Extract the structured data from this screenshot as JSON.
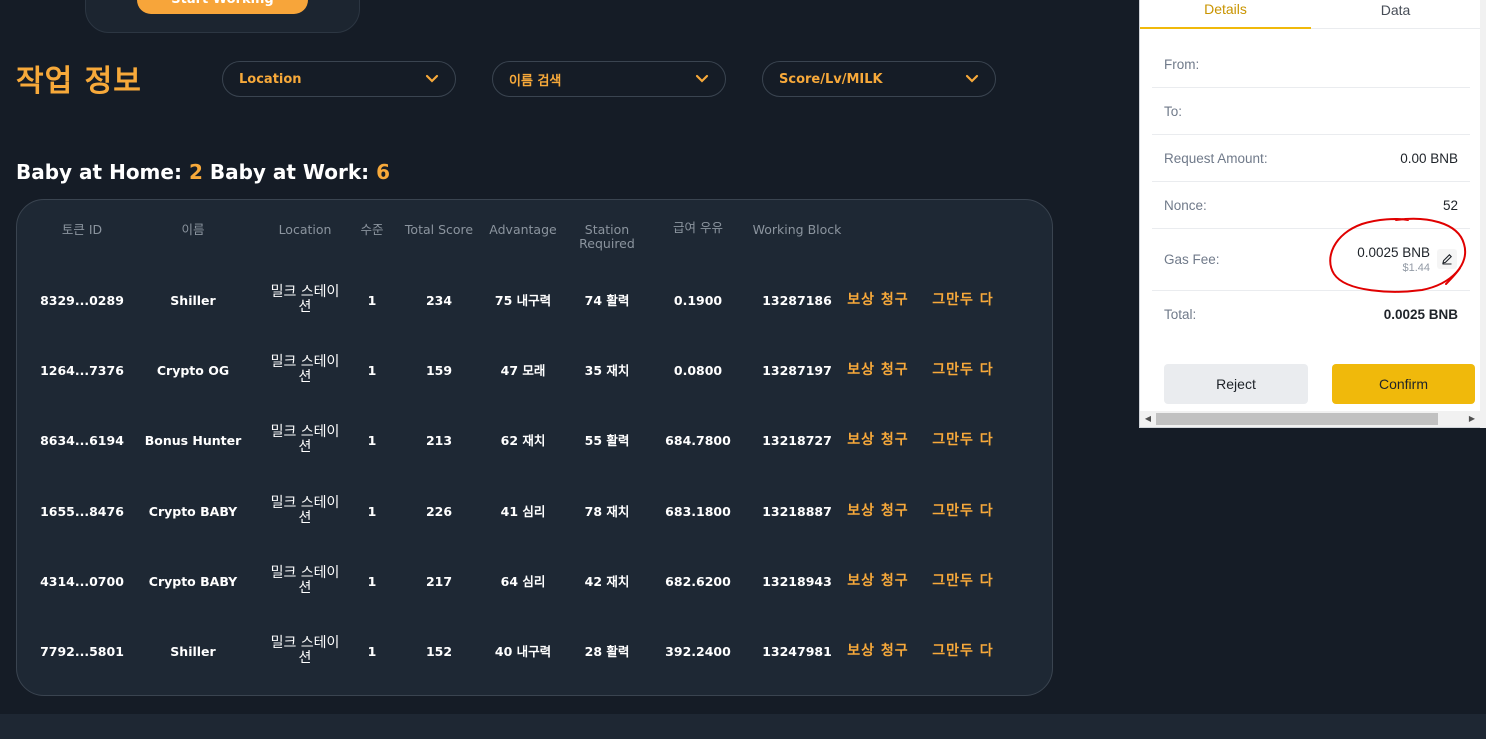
{
  "top": {
    "start_button": "Start Working"
  },
  "page_title": "작업 정보",
  "filters": [
    {
      "label": "Location"
    },
    {
      "label": "이름 검색"
    },
    {
      "label": "Score/Lv/MILK"
    }
  ],
  "summary": {
    "home_label": "Baby at Home:",
    "home_count": "2",
    "work_label": "Baby at Work:",
    "work_count": "6"
  },
  "table": {
    "headers": [
      "토큰 ID",
      "이름",
      "Location",
      "수준",
      "Total Score",
      "Advantage",
      "Station Required",
      "급여 우유",
      "Working Block"
    ],
    "rows": [
      {
        "token_id": "8329...0289",
        "name": "Shiller",
        "location": "밀크 스테이션",
        "level": "1",
        "total_score": "234",
        "advantage": "75 내구력",
        "station": "74 활력",
        "milk": "0.1900",
        "block": "13287186",
        "claim": "보상 청구",
        "quit": "그만두 다"
      },
      {
        "token_id": "1264...7376",
        "name": "Crypto OG",
        "location": "밀크 스테이션",
        "level": "1",
        "total_score": "159",
        "advantage": "47 모래",
        "station": "35 재치",
        "milk": "0.0800",
        "block": "13287197",
        "claim": "보상 청구",
        "quit": "그만두 다"
      },
      {
        "token_id": "8634...6194",
        "name": "Bonus Hunter",
        "location": "밀크 스테이션",
        "level": "1",
        "total_score": "213",
        "advantage": "62 재치",
        "station": "55 활력",
        "milk": "684.7800",
        "block": "13218727",
        "claim": "보상 청구",
        "quit": "그만두 다"
      },
      {
        "token_id": "1655...8476",
        "name": "Crypto BABY",
        "location": "밀크 스테이션",
        "level": "1",
        "total_score": "226",
        "advantage": "41 심리",
        "station": "78 재치",
        "milk": "683.1800",
        "block": "13218887",
        "claim": "보상 청구",
        "quit": "그만두 다"
      },
      {
        "token_id": "4314...0700",
        "name": "Crypto BABY",
        "location": "밀크 스테이션",
        "level": "1",
        "total_score": "217",
        "advantage": "64 심리",
        "station": "42 재치",
        "milk": "682.6200",
        "block": "13218943",
        "claim": "보상 청구",
        "quit": "그만두 다"
      },
      {
        "token_id": "7792...5801",
        "name": "Shiller",
        "location": "밀크 스테이션",
        "level": "1",
        "total_score": "152",
        "advantage": "40 내구력",
        "station": "28 활력",
        "milk": "392.2400",
        "block": "13247981",
        "claim": "보상 청구",
        "quit": "그만두 다"
      }
    ]
  },
  "wallet": {
    "tabs": [
      "Details",
      "Data"
    ],
    "from_label": "From:",
    "from_value": "",
    "to_label": "To:",
    "to_value": "",
    "amount_label": "Request Amount:",
    "amount_value": "0.00 BNB",
    "nonce_label": "Nonce:",
    "nonce_value": "52",
    "gas_label": "Gas Fee:",
    "gas_value": "0.0025 BNB",
    "gas_usd": "$1.44",
    "total_label": "Total:",
    "total_value": "0.0025 BNB",
    "reject": "Reject",
    "confirm": "Confirm"
  },
  "colors": {
    "accent": "#f7a93a",
    "background": "#151c26",
    "confirm": "#f0b90b",
    "annotation": "#e00000"
  },
  "icons": {
    "dropdown": "chevron-down-icon",
    "edit": "pencil-icon"
  }
}
